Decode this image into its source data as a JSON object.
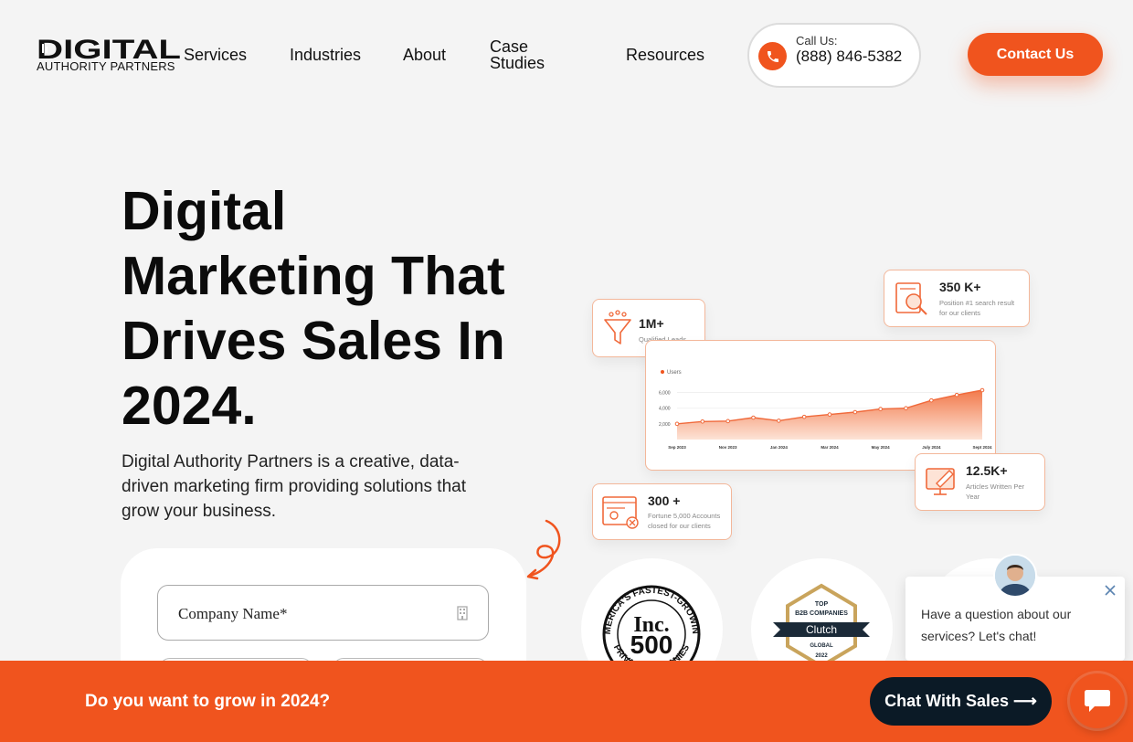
{
  "header": {
    "logo_word": "DIGITAL",
    "logo_sub": "AUTHORITY PARTNERS",
    "nav": [
      "Services",
      "Industries",
      "About",
      "Case Studies",
      "Resources"
    ],
    "call_label": "Call Us:",
    "call_number": "(888) 846-5382",
    "contact_label": "Contact Us"
  },
  "hero": {
    "title": "Digital Marketing That Drives Sales In 2024.",
    "description": "Digital Authority Partners is a creative, data-driven marketing firm providing solutions that grow your business."
  },
  "form": {
    "company_placeholder": "Company Name*"
  },
  "stats": [
    {
      "value": "1M+",
      "text": "Qualified Leads",
      "icon": "funnel-icon"
    },
    {
      "value": "350 K+",
      "text": "Position #1 search result for our clients",
      "icon": "search-document-icon"
    },
    {
      "value": "12.5K+",
      "text": "Articles Written Per Year",
      "icon": "edit-monitor-icon"
    },
    {
      "value": "300 +",
      "text": "Fortune 5,000 Accounts closed for our clients",
      "icon": "account-card-icon"
    }
  ],
  "chart_data": {
    "type": "area",
    "legend": [
      "Users"
    ],
    "categories": [
      "Sep 2023",
      "Nov 2023",
      "Jan 2024",
      "Mar 2024",
      "May 2024",
      "July 2024",
      "Sept 2024"
    ],
    "y_ticks": [
      "6,000",
      "4,000",
      "2,000"
    ],
    "ylim": [
      0,
      7000
    ],
    "series": [
      {
        "name": "Users",
        "values": [
          2000,
          2300,
          2350,
          2800,
          2400,
          2900,
          3200,
          3500,
          3900,
          4000,
          5000,
          5700,
          6300
        ]
      }
    ],
    "colors": {
      "line": "#f0693a",
      "fill_top": "#f27a4c",
      "fill_bottom": "#fde3d6"
    }
  },
  "badges": {
    "inc": {
      "top_text": "AMERICA'S FASTEST-GROWING",
      "main": "Inc.",
      "number": "500",
      "bottom_text": "PRIVATE COMPANIES"
    },
    "clutch": {
      "line1": "TOP",
      "line2": "B2B COMPANIES",
      "brand": "Clutch",
      "line3": "GLOBAL",
      "year": "2022"
    }
  },
  "chat_popup": {
    "text": "Have a question about our services? Let's chat!"
  },
  "bottom_bar": {
    "text": "Do you want to grow in 2024?",
    "chat_sales": "Chat With Sales ⟶"
  },
  "colors": {
    "accent": "#f0541e",
    "dark": "#0b1a26",
    "background": "#f4f4f4"
  }
}
